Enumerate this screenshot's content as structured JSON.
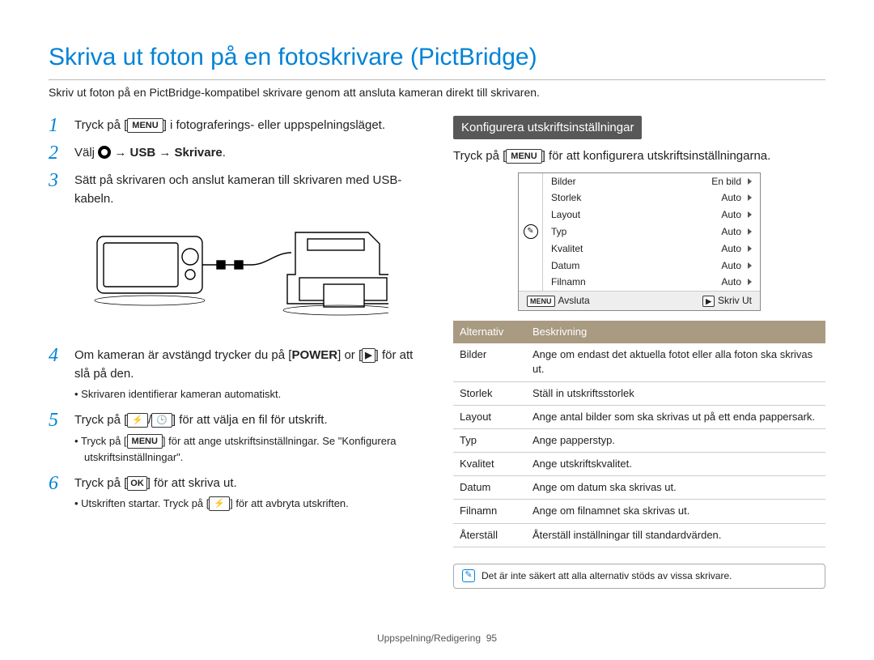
{
  "title": "Skriva ut foton på en fotoskrivare (PictBridge)",
  "intro": "Skriv ut foton på en PictBridge-kompatibel skrivare genom att ansluta kameran direkt till skrivaren.",
  "steps": {
    "s1_a": "Tryck på [",
    "s1_menu": "MENU",
    "s1_b": "] i fotograferings- eller uppspelningsläget.",
    "s2_a": "Välj ",
    "s2_b": " → ",
    "s2_usb": "USB",
    "s2_c": " → ",
    "s2_printer": "Skrivare",
    "s2_d": ".",
    "s3": "Sätt på skrivaren och anslut kameran till skrivaren med USB-kabeln.",
    "s4_a": "Om kameran är avstängd trycker du på [",
    "s4_power": "POWER",
    "s4_b": "] or [",
    "s4_c": "] för att slå på den.",
    "s4_sub": "Skrivaren identifierar kameran automatiskt.",
    "s5_a": "Tryck på [",
    "s5_b": "/",
    "s5_c": "] för att välja en fil för utskrift.",
    "s5_sub_a": "Tryck på [",
    "s5_sub_menu": "MENU",
    "s5_sub_b": "] för att ange utskriftsinställningar. Se \"Konfigurera utskriftsinställningar\".",
    "s6_a": "Tryck på [",
    "s6_ok": "OK",
    "s6_b": "] för att skriva ut.",
    "s6_sub_a": "Utskriften startar. Tryck på [",
    "s6_sub_b": "] för att avbryta utskriften."
  },
  "right": {
    "heading": "Konfigurera utskriftsinställningar",
    "text_a": "Tryck på [",
    "text_menu": "MENU",
    "text_b": "] för att konfigurera utskriftsinställningarna."
  },
  "screen": {
    "rows": [
      {
        "label": "Bilder",
        "val": "En bild"
      },
      {
        "label": "Storlek",
        "val": "Auto"
      },
      {
        "label": "Layout",
        "val": "Auto"
      },
      {
        "label": "Typ",
        "val": "Auto"
      },
      {
        "label": "Kvalitet",
        "val": "Auto"
      },
      {
        "label": "Datum",
        "val": "Auto"
      },
      {
        "label": "Filnamn",
        "val": "Auto"
      }
    ],
    "footer_left_key": "MENU",
    "footer_left": "Avsluta",
    "footer_right": "Skriv Ut"
  },
  "table": {
    "col1": "Alternativ",
    "col2": "Beskrivning",
    "rows": [
      {
        "opt": "Bilder",
        "desc": "Ange om endast det aktuella fotot eller alla foton ska skrivas ut."
      },
      {
        "opt": "Storlek",
        "desc": "Ställ in utskriftsstorlek"
      },
      {
        "opt": "Layout",
        "desc": "Ange antal bilder som ska skrivas ut på ett enda pappersark."
      },
      {
        "opt": "Typ",
        "desc": "Ange papperstyp."
      },
      {
        "opt": "Kvalitet",
        "desc": "Ange utskriftskvalitet."
      },
      {
        "opt": "Datum",
        "desc": "Ange om datum ska skrivas ut."
      },
      {
        "opt": "Filnamn",
        "desc": "Ange om filnamnet ska skrivas ut."
      },
      {
        "opt": "Återställ",
        "desc": "Återställ inställningar till standardvärden."
      }
    ]
  },
  "note": "Det är inte säkert att alla alternativ stöds av vissa skrivare.",
  "footer": {
    "section": "Uppspelning/Redigering",
    "page": "95"
  }
}
